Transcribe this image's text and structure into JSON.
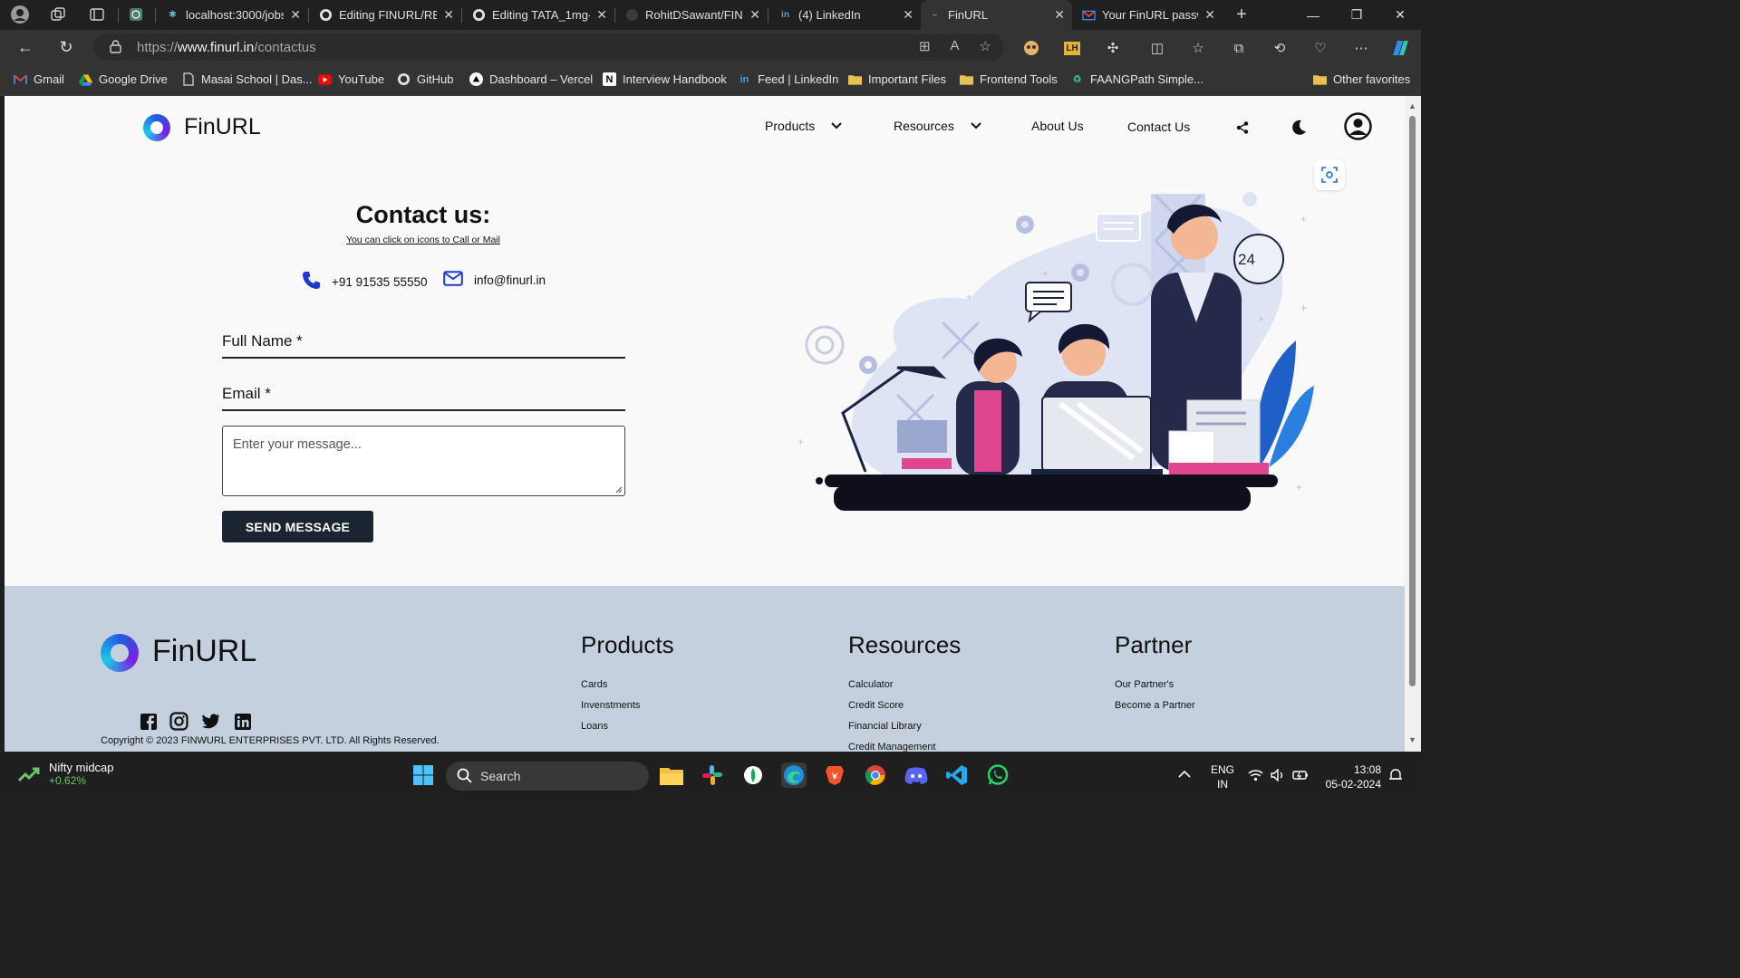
{
  "browser": {
    "tabs": [
      {
        "label": "localhost:3000/jobs",
        "icon": "react-icon"
      },
      {
        "label": "Editing FINURL/README",
        "icon": "github-icon"
      },
      {
        "label": "Editing TATA_1mg-",
        "icon": "github-icon"
      },
      {
        "label": "RohitDSawant/FINURL",
        "icon": "github-icon"
      },
      {
        "label": "(4) LinkedIn",
        "icon": "linkedin-icon"
      },
      {
        "label": "FinURL",
        "icon": "finurl-icon"
      },
      {
        "label": "Your FinURL passw",
        "icon": "gmail-icon"
      }
    ],
    "url_prefix": "https://",
    "url_domain": "www.finurl.in",
    "url_path": "/contactus",
    "bookmarks": [
      {
        "label": "Gmail",
        "icon": "gmail-icon"
      },
      {
        "label": "Google Drive",
        "icon": "google-drive-icon"
      },
      {
        "label": "Masai School | Das...",
        "icon": "page-icon"
      },
      {
        "label": "YouTube",
        "icon": "youtube-icon"
      },
      {
        "label": "GitHub",
        "icon": "github-icon"
      },
      {
        "label": "Dashboard – Vercel",
        "icon": "vercel-icon"
      },
      {
        "label": "Interview Handbook",
        "icon": "notion-icon"
      },
      {
        "label": "Feed | LinkedIn",
        "icon": "linkedin-icon"
      },
      {
        "label": "Important Files",
        "icon": "folder-icon"
      },
      {
        "label": "Frontend Tools",
        "icon": "folder-icon"
      },
      {
        "label": "FAANGPath Simple...",
        "icon": "faangpath-icon"
      }
    ],
    "other_favorites": "Other favorites"
  },
  "site": {
    "brand": "FinURL",
    "nav": {
      "products": "Products",
      "resources": "Resources",
      "about": "About Us",
      "contact": "Contact Us"
    },
    "contact": {
      "title": "Contact us:",
      "subtitle": "You can click on icons to Call or Mail",
      "phone": "+91 91535 55550",
      "email": "info@finurl.in"
    },
    "form": {
      "full_name_label": "Full Name *",
      "email_label": "Email *",
      "message_placeholder": "Enter your message...",
      "send_label": "SEND MESSAGE"
    },
    "illustration": {
      "badge_text": "24"
    },
    "footer": {
      "brand": "FinURL",
      "products_title": "Products",
      "products_links": [
        "Cards",
        "Invenstments",
        "Loans"
      ],
      "resources_title": "Resources",
      "resources_links": [
        "Calculator",
        "Credit Score",
        "Financial Library",
        "Credit Management"
      ],
      "partner_title": "Partner",
      "partner_links": [
        "Our Partner's",
        "Become a Partner"
      ],
      "copyright": "Copyright © 2023 FINWURL ENTERPRISES PVT. LTD. All Rights Reserved."
    }
  },
  "taskbar": {
    "widget_title": "Nifty midcap",
    "widget_value": "+0.62%",
    "search_label": "Search",
    "lang_line1": "ENG",
    "lang_line2": "IN",
    "time": "13:08",
    "date": "05-02-2024"
  },
  "colors": {
    "accent_navy": "#1b2431",
    "phone_icon": "#1a3ad1",
    "footer_bg": "#c4d0de",
    "widget_green": "#6cc56a"
  }
}
